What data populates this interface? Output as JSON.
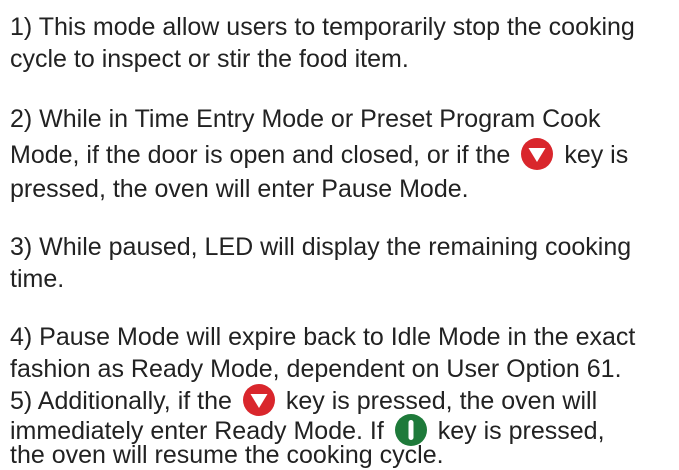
{
  "paragraphs": [
    {
      "lines": [
        "1) This mode allow users to temporarily stop the cooking",
        "cycle to inspect or stir the food item."
      ]
    },
    {
      "lines": [
        "2) While in Time Entry Mode or Preset Program Cook",
        "Mode, if the door is open and closed, or if the",
        "key is",
        "pressed, the oven will enter Pause Mode."
      ]
    },
    {
      "lines": [
        "3) While paused, LED will display the remaining cooking",
        "time."
      ]
    },
    {
      "lines": [
        "4) Pause Mode will expire back to Idle Mode in the exact",
        "fashion as Ready Mode, dependent on User Option 61.",
        "5) Additionally, if the",
        "key is pressed, the oven will",
        "immediately enter Ready Mode. If",
        "key is pressed,",
        "the oven will resume the cooking cycle."
      ]
    }
  ],
  "icons": {
    "stop_key": {
      "name": "red-down-triangle-key-icon",
      "color": "#d9262c"
    },
    "start_key": {
      "name": "green-start-key-icon",
      "color": "#1e7a3a"
    }
  }
}
